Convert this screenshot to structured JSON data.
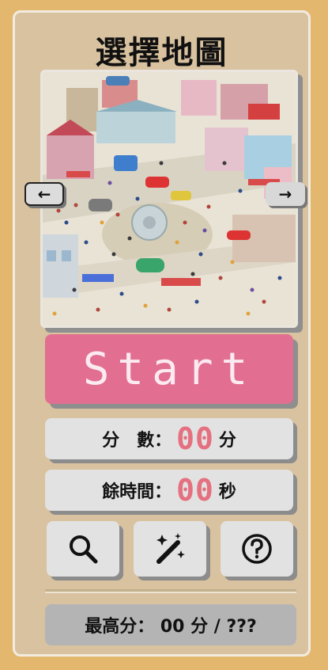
{
  "title": "選擇地圖",
  "nav": {
    "prev": "←",
    "next": "→"
  },
  "start_label": "Start",
  "score": {
    "label": "分　數：",
    "value": "00",
    "unit": "分"
  },
  "time": {
    "label": "餘時間：",
    "value": "00",
    "unit": "秒"
  },
  "tools": {
    "search": "search-icon",
    "magic": "magic-wand-icon",
    "help": "help-icon"
  },
  "best": "最高分： 00 分 / ???",
  "colors": {
    "accent": "#e26f92",
    "digits": "#e5707f",
    "frame": "#e3b86e",
    "panel": "#d9c29f"
  }
}
